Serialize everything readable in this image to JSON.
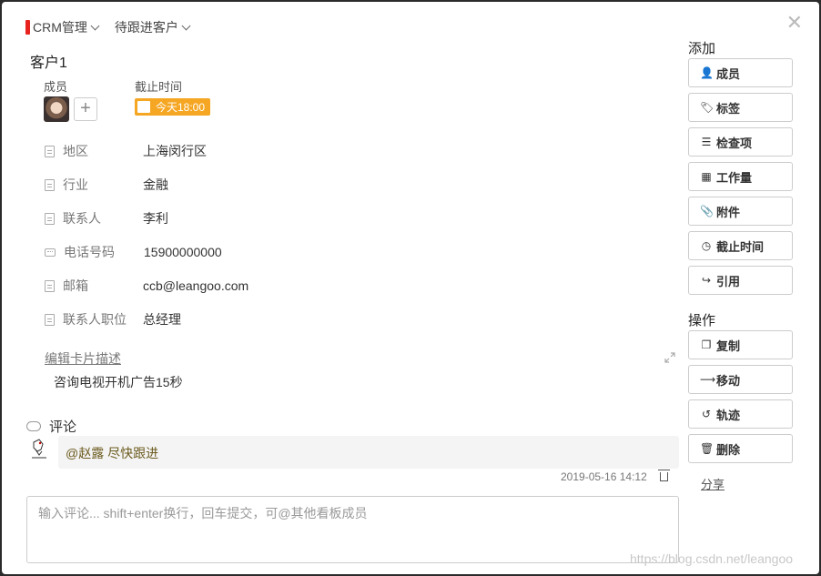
{
  "breadcrumb": {
    "board": "CRM管理",
    "list": "待跟进客户"
  },
  "card": {
    "title": "客户1",
    "members_label": "成员",
    "due_label": "截止时间",
    "due_value": "今天18:00",
    "due_color": "#f5a623",
    "fields": [
      {
        "icon": "document-icon",
        "key": "地区",
        "value": "上海闵行区"
      },
      {
        "icon": "document-icon",
        "key": "行业",
        "value": "金融"
      },
      {
        "icon": "document-icon",
        "key": "联系人",
        "value": "李利"
      },
      {
        "icon": "phone-icon",
        "key": "电话号码",
        "value": "15900000000"
      },
      {
        "icon": "document-icon",
        "key": "邮箱",
        "value": "ccb@leangoo.com"
      },
      {
        "icon": "document-icon",
        "key": "联系人职位",
        "value": "总经理"
      }
    ],
    "edit_desc_label": "编辑卡片描述",
    "description": "咨询电视开机广告15秒"
  },
  "comments": {
    "title": "评论",
    "items": [
      {
        "mention": "@赵露",
        "text": " 尽快跟进",
        "time": "2019-05-16 14:12"
      }
    ],
    "input_placeholder": "输入评论... shift+enter换行，回车提交，可@其他看板成员"
  },
  "sidebar": {
    "add_title": "添加",
    "add_buttons": [
      {
        "icon": "add-member-icon",
        "glyph": "👤",
        "label": "成员"
      },
      {
        "icon": "tag-icon",
        "glyph": "🏷",
        "label": "标签"
      },
      {
        "icon": "list-icon",
        "glyph": "☰",
        "label": "检查项"
      },
      {
        "icon": "grid-icon",
        "glyph": "▦",
        "label": "工作量"
      },
      {
        "icon": "paperclip-icon",
        "glyph": "📎",
        "label": "附件"
      },
      {
        "icon": "clock-icon",
        "glyph": "◷",
        "label": "截止时间"
      },
      {
        "icon": "share-arrow-icon",
        "glyph": "↪",
        "label": "引用"
      }
    ],
    "ops_title": "操作",
    "ops_buttons": [
      {
        "icon": "copy-icon",
        "glyph": "❐",
        "label": "复制"
      },
      {
        "icon": "move-arrow-icon",
        "glyph": "⟶",
        "label": "移动"
      },
      {
        "icon": "history-icon",
        "glyph": "↺",
        "label": "轨迹"
      },
      {
        "icon": "trash-icon",
        "glyph": "🗑",
        "label": "删除"
      }
    ],
    "share_label": "分享"
  },
  "watermark": "https://blog.csdn.net/leangoo"
}
